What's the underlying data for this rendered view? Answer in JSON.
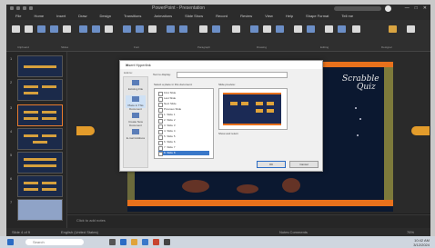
{
  "window": {
    "title": "PowerPoint - Presentation",
    "controls": [
      "—",
      "□",
      "✕"
    ]
  },
  "menu": [
    "File",
    "Home",
    "Insert",
    "Draw",
    "Design",
    "Transitions",
    "Animations",
    "Slide Show",
    "Record",
    "Review",
    "View",
    "Help",
    "Shape Format",
    "Tell me"
  ],
  "ribbon": {
    "groups": [
      "Clipboard",
      "Slides",
      "Font",
      "Paragraph",
      "Drawing",
      "Editing",
      "Designer"
    ]
  },
  "slides": {
    "numbers": [
      "1",
      "2",
      "3",
      "4",
      "5",
      "6",
      "7"
    ]
  },
  "slide": {
    "brand_line1": "Scrabble",
    "brand_line2": "Quiz"
  },
  "dialog": {
    "title": "Insert Hyperlink",
    "close": "✕",
    "link_to_label": "Link to:",
    "text_display_label": "Text to display:",
    "select_place_label": "Select a place in this document:",
    "preview_label": "Slide preview:",
    "categories": [
      "Existing File",
      "Place in This Document",
      "Create New Document",
      "E-mail Address"
    ],
    "items": [
      "First Slide",
      "Last Slide",
      "Next Slide",
      "Previous Slide",
      "1. Slide 1",
      "2. Slide 2",
      "3. Slide 3",
      "4. Slide 4",
      "5. Slide 5",
      "6. Slide 6",
      "7. Slide 7",
      "8. Slide 8",
      "9. Slide 9"
    ],
    "selected_index": 11,
    "show_return": "Show and return",
    "ok": "OK",
    "cancel": "Cancel"
  },
  "notes": {
    "placeholder": "Click to add notes"
  },
  "status": {
    "left": "Slide 4 of 9",
    "lang": "English (United States)",
    "right": "Notes  Comments",
    "zoom": "76%"
  },
  "taskbar": {
    "search_placeholder": "Search",
    "time": "10:42 AM",
    "date": "3/12/2024"
  }
}
